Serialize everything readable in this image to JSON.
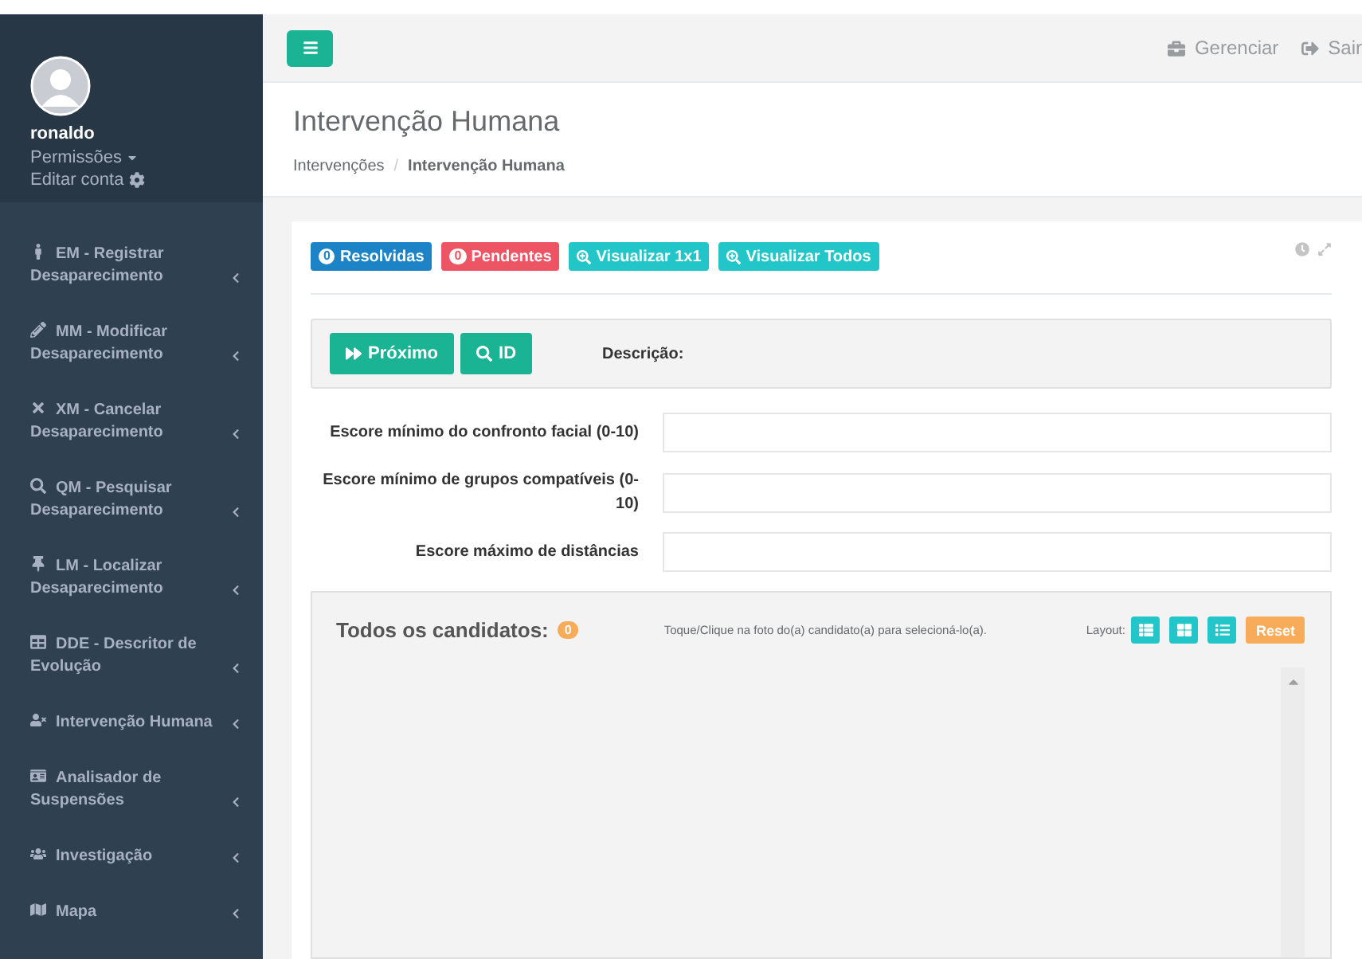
{
  "sidebar": {
    "user": {
      "name": "ronaldo",
      "permissions": "Permissões",
      "edit_account": "Editar conta"
    },
    "items": [
      {
        "label": "EM - Registrar Desaparecimento"
      },
      {
        "label": "MM - Modificar Desaparecimento"
      },
      {
        "label": "XM - Cancelar Desaparecimento"
      },
      {
        "label": "QM - Pesquisar Desaparecimento"
      },
      {
        "label": "LM - Localizar Desaparecimento"
      },
      {
        "label": "DDE - Descritor de Evolução"
      },
      {
        "label": "Intervenção Humana"
      },
      {
        "label": "Analisador de Suspensões"
      },
      {
        "label": "Investigação"
      },
      {
        "label": "Mapa"
      }
    ]
  },
  "topbar": {
    "links": [
      "Gerenciar",
      "Sair"
    ]
  },
  "page": {
    "title": "Intervenção Humana",
    "separator": "/",
    "breadcrumb": [
      {
        "label": "Intervenções",
        "selected": false
      },
      {
        "label": "Intervenção Humana",
        "selected": true
      }
    ]
  },
  "tags": [
    {
      "kind": "count",
      "color": "#1c84c6",
      "count": "0",
      "label": "Resolvidas"
    },
    {
      "kind": "count",
      "color": "#ed5565",
      "count": "0",
      "label": "Pendentes"
    },
    {
      "kind": "view",
      "color": "#23c6c8",
      "label": "Visualizar 1x1"
    },
    {
      "kind": "view",
      "color": "#23c6c8",
      "label": "Visualizar Todos"
    }
  ],
  "actions": {
    "buttons": [
      {
        "kind": "next",
        "label": "Próximo"
      },
      {
        "kind": "search",
        "label": "ID"
      }
    ],
    "description_label": "Descrição:"
  },
  "fields": [
    {
      "label": "Escore mínimo do confronto facial (0-10)"
    },
    {
      "label": "Escore mínimo de grupos compatíveis (0-10)"
    },
    {
      "label": "Escore máximo de distâncias"
    }
  ],
  "candidates": {
    "title": "Todos os candidatos:",
    "count": "0",
    "hint": "Toque/Clique na foto do(a) candidato(a) para selecioná-lo(a).",
    "layout_label": "Layout:",
    "reset": "Reset"
  }
}
